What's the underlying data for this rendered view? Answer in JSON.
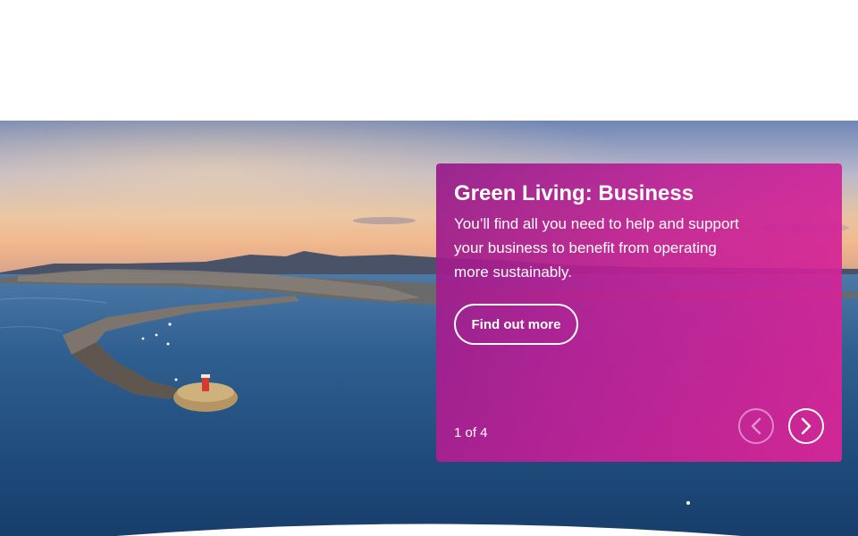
{
  "hero": {
    "image_alt": "Aerial view of a harbour pier with a red lighthouse and a coastal town at sunset",
    "card": {
      "title": "Green Living: Business",
      "body": "You’ll find all you need to help and support your business to benefit from operating more sustainably.",
      "cta_label": "Find out more",
      "pager_text": "1 of 4",
      "prev_icon": "chevron-left-icon",
      "next_icon": "chevron-right-icon"
    }
  },
  "colors": {
    "card_gradient_start": "#961c8a",
    "card_gradient_end": "#e02498",
    "text": "#ffffff"
  }
}
